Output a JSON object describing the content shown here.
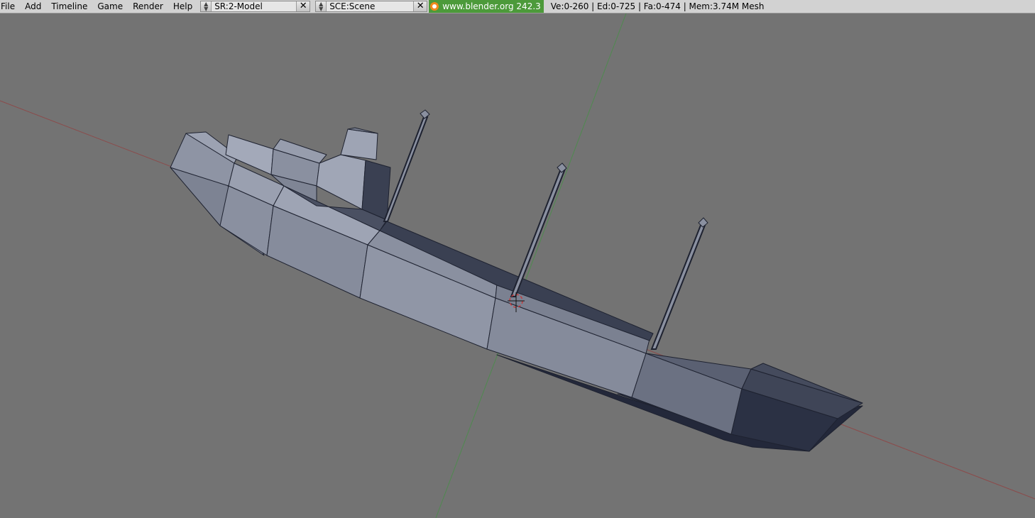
{
  "menu": [
    "File",
    "Add",
    "Timeline",
    "Game",
    "Render",
    "Help"
  ],
  "screen_browse": {
    "name": "SR:2-Model"
  },
  "scene_browse": {
    "name": "SCE:Scene"
  },
  "version_info": "www.blender.org 242.3",
  "stats": "Ve:0-260 | Ed:0-725 | Fa:0-474 | Mem:3.74M Mesh",
  "colors": {
    "viewport_bg": "#737373",
    "x_axis": "#8c4a4a",
    "y_axis": "#4f8a4f",
    "mesh_light": "#9ba1b1",
    "mesh_dark": "#23283a",
    "header_bg": "#d2d2d2"
  },
  "icons": [
    "updown-arrows-icon",
    "close-x-icon",
    "blender-logo-icon",
    "3d-cursor-icon"
  ]
}
